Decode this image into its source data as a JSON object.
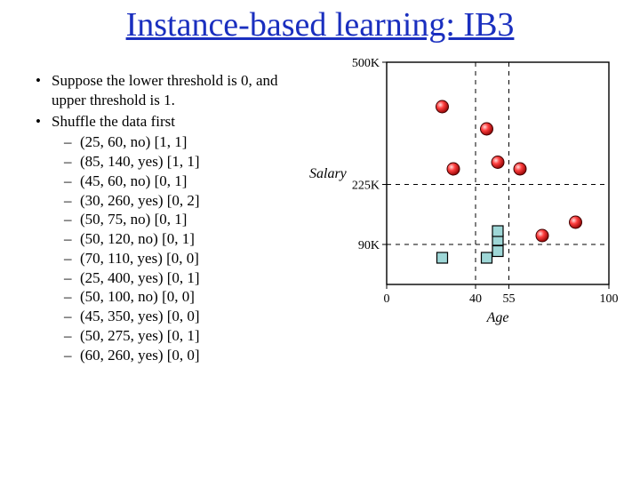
{
  "title": "Instance-based learning: IB3",
  "bullets": [
    {
      "text": "Suppose the lower threshold is 0, and upper threshold is 1."
    },
    {
      "text": "Shuffle the data first",
      "sub": [
        "(25, 60, no) [1, 1]",
        "(85, 140, yes) [1, 1]",
        "(45, 60, no) [0, 1]",
        "(30, 260, yes) [0, 2]",
        "(50, 75, no) [0, 1]",
        "(50, 120, no) [0, 1]",
        "(70, 110, yes) [0, 0]",
        "(25, 400, yes) [0, 1]",
        "(50, 100, no) [0, 0]",
        "(45, 350, yes) [0, 0]",
        "(50, 275, yes) [0, 1]",
        "(60, 260, yes) [0, 0]"
      ]
    }
  ],
  "chart_data": {
    "type": "scatter",
    "xlabel": "Age",
    "ylabel": "Salary",
    "xticks": [
      0,
      40,
      55,
      100
    ],
    "yticks_labels": [
      "90K",
      "225K",
      "500K"
    ],
    "yticks_values": [
      90,
      225,
      500
    ],
    "xlim": [
      0,
      100
    ],
    "ylim": [
      0,
      500
    ],
    "grid_x": [
      40,
      55
    ],
    "grid_y": [
      90,
      225
    ],
    "series": [
      {
        "name": "no",
        "marker": "square-teal",
        "points": [
          {
            "x": 25,
            "y": 60
          },
          {
            "x": 45,
            "y": 60
          },
          {
            "x": 50,
            "y": 75
          },
          {
            "x": 50,
            "y": 100
          },
          {
            "x": 50,
            "y": 120
          }
        ]
      },
      {
        "name": "yes",
        "marker": "circle-red",
        "points": [
          {
            "x": 25,
            "y": 400
          },
          {
            "x": 30,
            "y": 260
          },
          {
            "x": 45,
            "y": 350
          },
          {
            "x": 50,
            "y": 275
          },
          {
            "x": 60,
            "y": 260
          },
          {
            "x": 70,
            "y": 110
          },
          {
            "x": 85,
            "y": 140
          }
        ]
      }
    ]
  }
}
